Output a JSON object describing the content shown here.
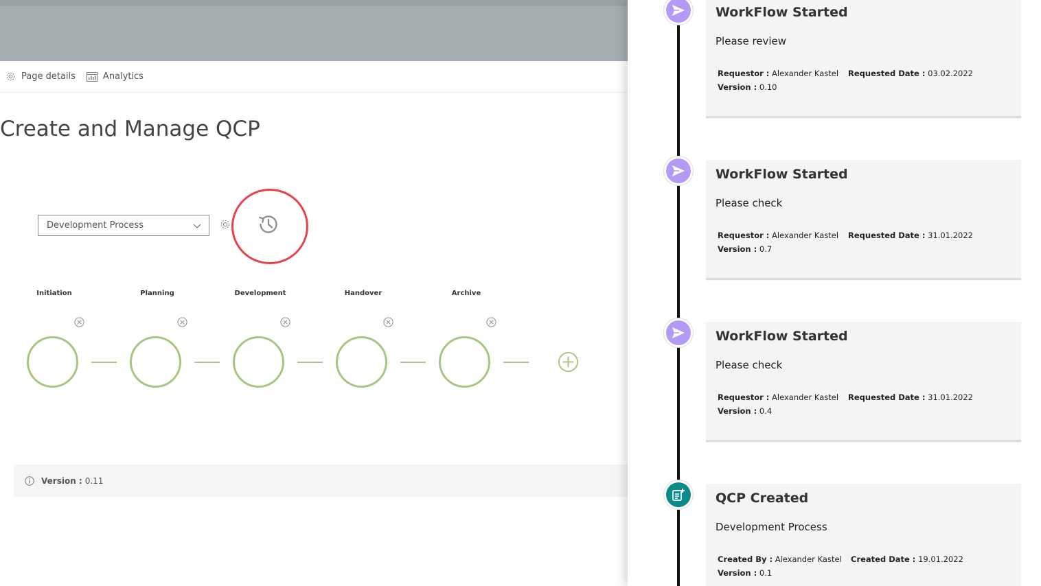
{
  "command_bar": {
    "page_details": "Page details",
    "analytics": "Analytics"
  },
  "page": {
    "title": "Create and Manage QCP",
    "process_select": {
      "value": "Development Process"
    }
  },
  "phases": [
    {
      "label": "Initiation"
    },
    {
      "label": "Planning"
    },
    {
      "label": "Development"
    },
    {
      "label": "Handover"
    },
    {
      "label": "Archive"
    }
  ],
  "version_bar": {
    "label": "Version :",
    "value": "0.11"
  },
  "colors": {
    "phase_green": "#a7c583",
    "highlight_red": "#e8424a",
    "node_purple": "#b39bf5",
    "node_teal": "#0a8a8a"
  },
  "timeline": [
    {
      "icon": "send-icon",
      "title": "WorkFlow Started",
      "message": "Please review",
      "left_label": "Requestor :",
      "left_value": "Alexander Kastel",
      "right_label": "Requested Date :",
      "right_value": "03.02.2022",
      "version_label": "Version :",
      "version_value": "0.10"
    },
    {
      "icon": "send-icon",
      "title": "WorkFlow Started",
      "message": "Please check",
      "left_label": "Requestor :",
      "left_value": "Alexander Kastel",
      "right_label": "Requested Date :",
      "right_value": "31.01.2022",
      "version_label": "Version :",
      "version_value": "0.7"
    },
    {
      "icon": "send-icon",
      "title": "WorkFlow Started",
      "message": "Please check",
      "left_label": "Requestor :",
      "left_value": "Alexander Kastel",
      "right_label": "Requested Date :",
      "right_value": "31.01.2022",
      "version_label": "Version :",
      "version_value": "0.4"
    },
    {
      "icon": "document-add-icon",
      "title": "QCP Created",
      "message": "Development Process",
      "left_label": "Created By :",
      "left_value": "Alexander Kastel",
      "right_label": "Created Date :",
      "right_value": "19.01.2022",
      "version_label": "Version :",
      "version_value": "0.1"
    }
  ]
}
